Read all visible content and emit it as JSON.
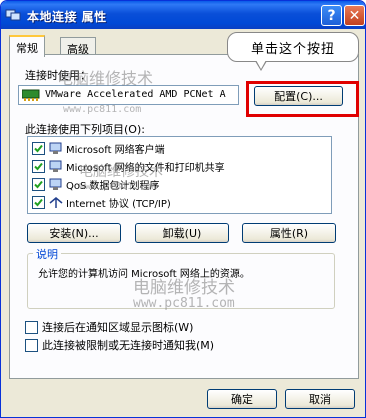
{
  "window": {
    "title": "本地连接 属性",
    "help_glyph": "?",
    "close_glyph": "✕"
  },
  "tabs": [
    {
      "label": "常规",
      "active": true
    },
    {
      "label": "高级",
      "active": false
    }
  ],
  "connect_using_label": "连接时使用：",
  "adapter_name": "VMware Accelerated AMD PCNet A",
  "configure_button": "配置(C)...",
  "callout": "单击这个按扭",
  "components_label": "此连接使用下列项目(O):",
  "components": [
    {
      "label": "Microsoft 网络客户端",
      "checked": true,
      "icon": "network-client-icon"
    },
    {
      "label": "Microsoft 网络的文件和打印机共享",
      "checked": true,
      "icon": "file-printer-sharing-icon"
    },
    {
      "label": "QoS 数据包计划程序",
      "checked": true,
      "icon": "qos-scheduler-icon"
    },
    {
      "label": "Internet 协议 (TCP/IP)",
      "checked": true,
      "icon": "protocol-icon"
    }
  ],
  "buttons": {
    "install": "安装(N)...",
    "uninstall": "卸载(U)",
    "properties": "属性(R)"
  },
  "description": {
    "title": "说明",
    "text": "允许您的计算机访问 Microsoft 网络上的资源。"
  },
  "options": [
    {
      "label": "连接后在通知区域显示图标(W)",
      "checked": false
    },
    {
      "label": "此连接被限制或无连接时通知我(M)",
      "checked": false
    }
  ],
  "footer": {
    "ok": "确定",
    "cancel": "取消"
  },
  "watermarks": {
    "site_name": "电脑维修技术",
    "url": "www.pc811.com"
  },
  "colors": {
    "titlebar": "#0a4fd8",
    "highlight": "#e00000",
    "group_title": "#0046d5"
  }
}
